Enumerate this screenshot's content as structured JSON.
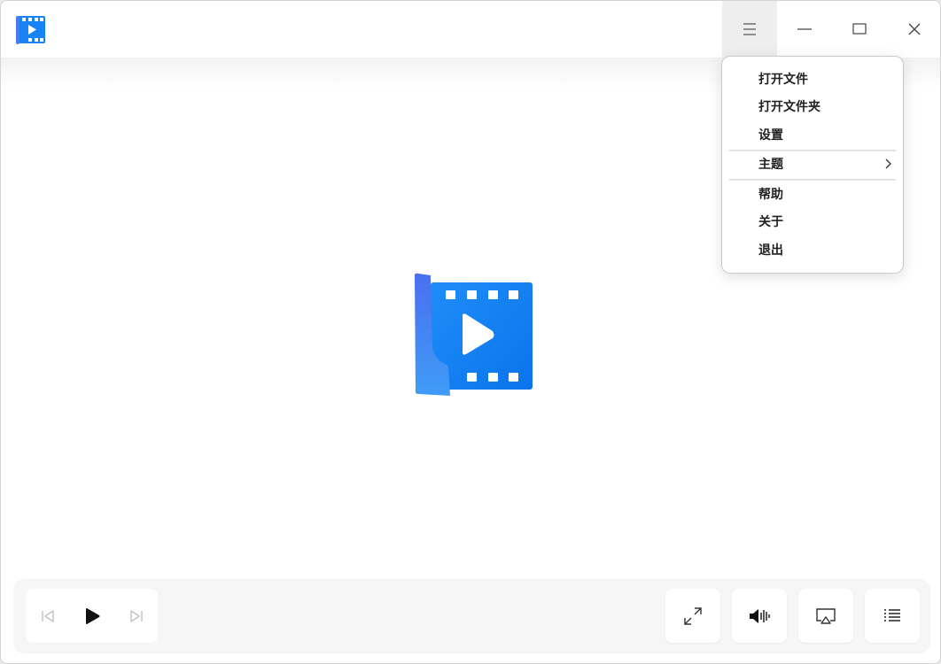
{
  "titlebar": {
    "app_icon": "movie-player-logo",
    "buttons": [
      "menu-icon",
      "minimize-icon",
      "maximize-icon",
      "close-icon"
    ]
  },
  "menu": {
    "items": [
      {
        "label": "打开文件"
      },
      {
        "label": "打开文件夹"
      },
      {
        "label": "设置"
      },
      {
        "label": "主题",
        "has_submenu": true
      },
      {
        "label": "帮助"
      },
      {
        "label": "关于"
      },
      {
        "label": "退出"
      }
    ]
  },
  "center": {
    "icon": "movie-player-logo"
  },
  "controls": {
    "playback": [
      "previous-icon",
      "play-icon",
      "next-icon"
    ],
    "right": [
      "fullscreen-icon",
      "volume-icon",
      "screencast-icon",
      "playlist-icon"
    ]
  },
  "colors": {
    "accent": "#1783f5",
    "accent_light": "#3aa0ff",
    "menu_hover_bg": "#eeeeee",
    "bottom_bar_bg": "#f6f6f6"
  }
}
